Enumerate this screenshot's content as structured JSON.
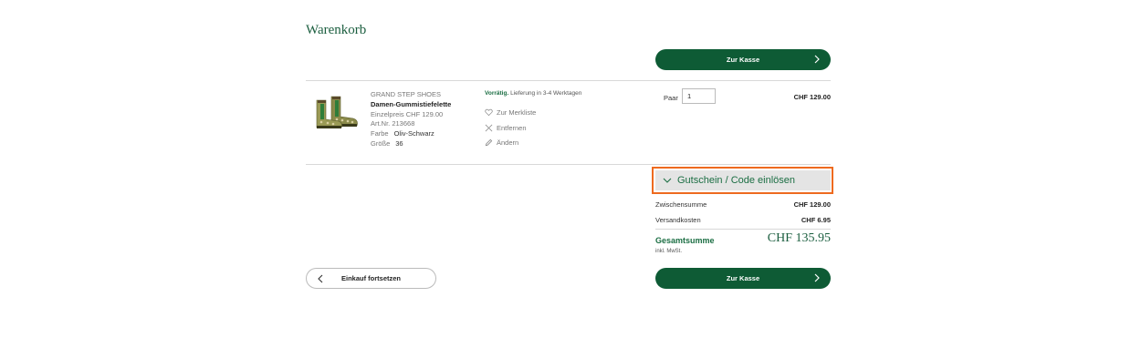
{
  "page": {
    "title": "Warenkorb"
  },
  "checkout": {
    "label": "Zur Kasse"
  },
  "item": {
    "brand": "GRAND STEP SHOES",
    "name": "Damen-Gummistiefelette",
    "unit_price": "Einzelpreis CHF 129.00",
    "art_nr": "Art.Nr. 213668",
    "color_label": "Farbe",
    "color_value": "Oliv-Schwarz",
    "size_label": "Größe",
    "size_value": "36",
    "availability_status": "Vorrätig.",
    "availability_text": "Lieferung in 3-4 Werktagen",
    "actions": {
      "wishlist": "Zur Merkliste",
      "remove": "Entfernen",
      "edit": "Ändern"
    },
    "qty_label": "Paar",
    "qty_value": "1",
    "price": "CHF 129.00"
  },
  "coupon": {
    "label": "Gutschein / Code einlösen"
  },
  "summary": {
    "subtotal_label": "Zwischensumme",
    "subtotal_value": "CHF 129.00",
    "shipping_label": "Versandkosten",
    "shipping_value": "CHF 6.95",
    "total_label": "Gesamtsumme",
    "total_value": "CHF 135.95",
    "vat_note": "inkl. MwSt."
  },
  "continue": {
    "label": "Einkauf fortsetzen"
  },
  "colors": {
    "brand_green": "#0e5b35",
    "highlight_orange": "#ee6a1f"
  }
}
